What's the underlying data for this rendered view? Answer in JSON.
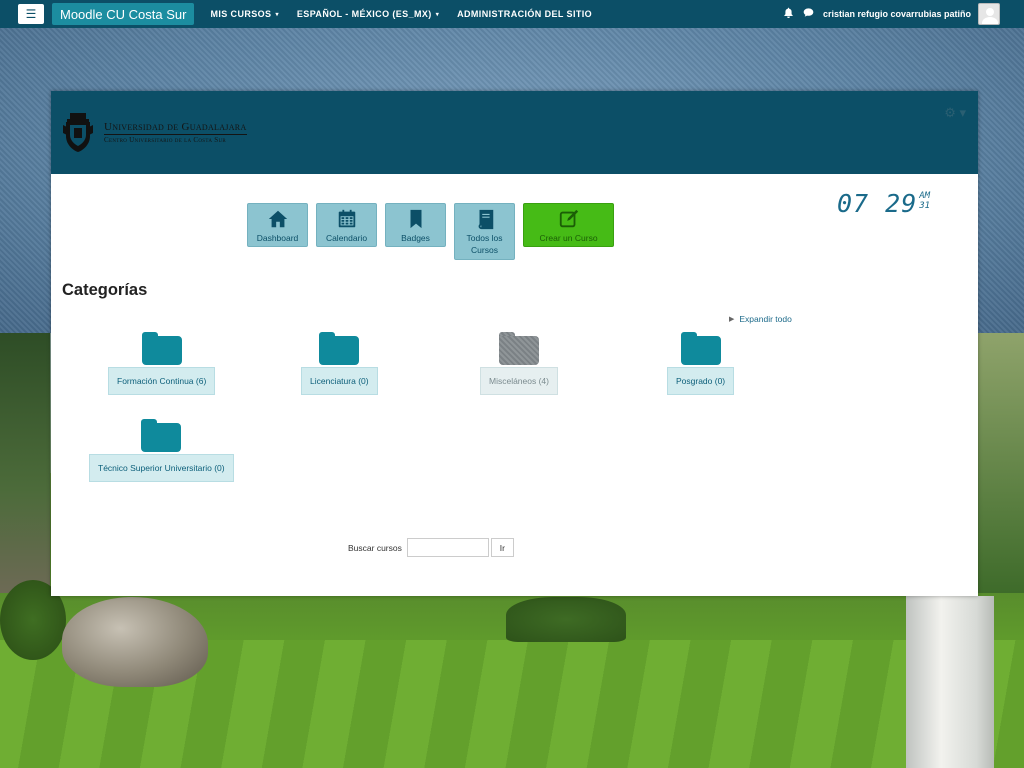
{
  "navbar": {
    "menu_icon": "hamburger-icon",
    "brand": "Moodle CU Costa Sur",
    "items": [
      {
        "label": "MIS CURSOS",
        "dropdown": true
      },
      {
        "label": "ESPAÑOL - MÉXICO (ES_MX)",
        "dropdown": true
      },
      {
        "label": "ADMINISTRACIÓN DEL SITIO",
        "dropdown": false
      }
    ],
    "notifications_icon": "bell-icon",
    "messages_icon": "chat-icon",
    "user_name": "cristian refugio covarrubias patiño",
    "caret": "▾"
  },
  "header": {
    "logo_line1": "Universidad de Guadalajara",
    "logo_line2": "Centro Universitario de la Costa Sur",
    "gear_icon": "gear-icon",
    "gear_glyph": "⚙ ▾",
    "background_color": "#0c4f67"
  },
  "quick_links": [
    {
      "label": "Dashboard",
      "icon": "home-icon"
    },
    {
      "label": "Calendario",
      "icon": "calendar-icon"
    },
    {
      "label": "Badges",
      "icon": "bookmark-icon"
    },
    {
      "label": "Todos los Cursos",
      "icon": "book-icon"
    },
    {
      "label": "Crear un Curso",
      "icon": "edit-icon"
    }
  ],
  "clock": {
    "time": "07 29",
    "ampm": "AM",
    "seconds": "31"
  },
  "categories": {
    "title": "Categorías",
    "expand_label": "Expandir todo",
    "items": [
      {
        "label": "Formación Continua (6)",
        "dimmed": false
      },
      {
        "label": "Licenciatura (0)",
        "dimmed": false
      },
      {
        "label": "Misceláneos (4)",
        "dimmed": true
      },
      {
        "label": "Posgrado (0)",
        "dimmed": false
      },
      {
        "label": "Técnico Superior Universitario (0)",
        "dimmed": false
      }
    ]
  },
  "search": {
    "label": "Buscar cursos",
    "value": "",
    "button": "Ir"
  },
  "colors": {
    "primary": "#0c4f67",
    "accent": "#1c8da0",
    "folder": "#0f8a9c",
    "create_button": "#46bb16"
  }
}
